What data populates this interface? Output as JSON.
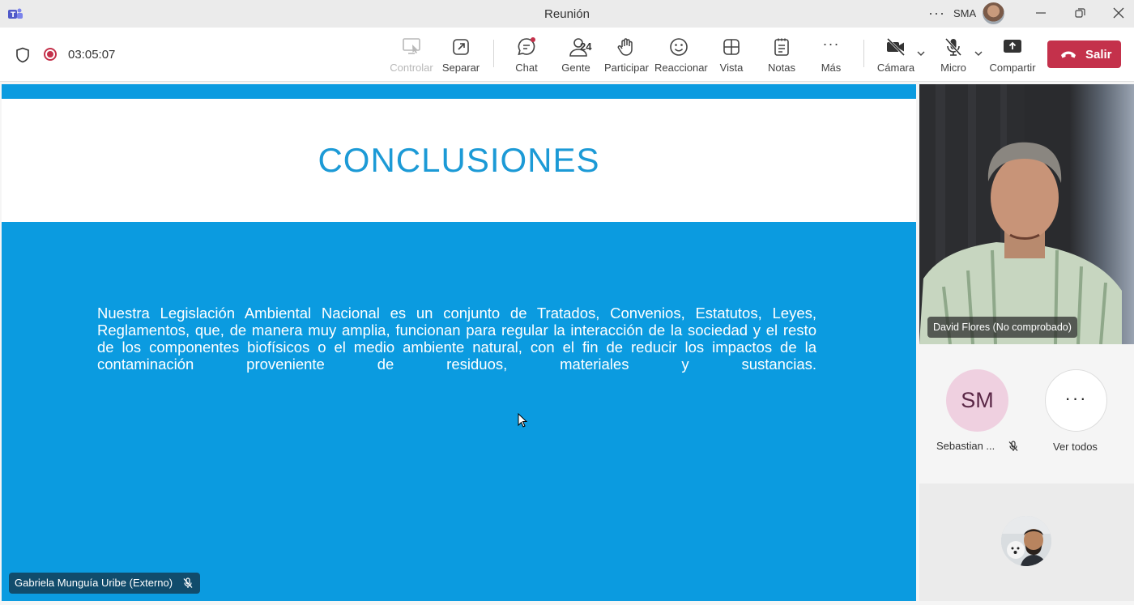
{
  "window": {
    "title": "Reunión",
    "user_initials": "SMA",
    "more_glyph": "···"
  },
  "toolbar": {
    "timer": "03:05:07",
    "control_label": "Controlar",
    "separate_label": "Separar",
    "chat_label": "Chat",
    "people_label": "Gente",
    "people_count": "24",
    "raise_label": "Participar",
    "react_label": "Reaccionar",
    "view_label": "Vista",
    "notes_label": "Notas",
    "more_label": "Más",
    "more_glyph": "···",
    "camera_label": "Cámara",
    "mic_label": "Micro",
    "share_label": "Compartir",
    "leave_label": "Salir"
  },
  "slide": {
    "title": "CONCLUSIONES",
    "body": "Nuestra Legislación Ambiental Nacional es un conjunto de Tratados, Convenios, Estatutos, Leyes, Reglamentos, que, de manera muy amplia, funcionan para regular la interacción de la sociedad y el resto de los componentes biofísicos o el medio ambiente natural, con el fin de reducir los impactos de la contaminación proveniente de residuos, materiales y sustancias.",
    "presenter": "Gabriela Munguía Uribe (Externo)"
  },
  "participants": {
    "video_name": "David Flores (No comprobado)",
    "sm_initials": "SM",
    "sm_name": "Sebastian ...",
    "see_all_glyph": "···",
    "see_all_label": "Ver todos"
  },
  "colors": {
    "accent": "#c4314b",
    "slide_blue": "#0b9be0",
    "title_blue": "#1c9ad6"
  }
}
